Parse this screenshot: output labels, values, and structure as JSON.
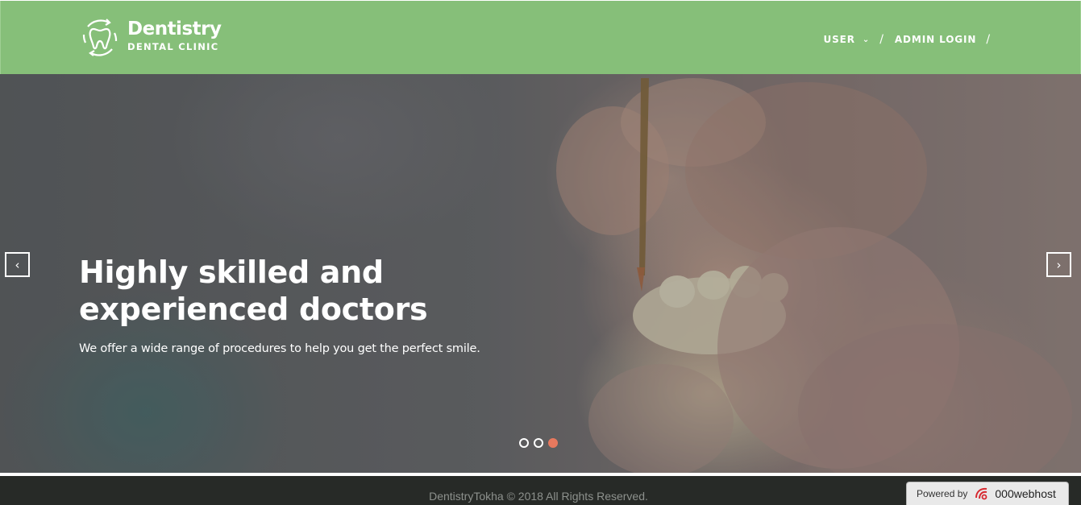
{
  "header": {
    "brand_title": "Dentistry",
    "brand_subtitle": "DENTAL CLINIC",
    "bg_color": "#86bf79",
    "nav": [
      {
        "label": "USER",
        "has_dropdown": true
      },
      {
        "label": "ADMIN LOGIN",
        "has_dropdown": false
      }
    ],
    "separator": "/"
  },
  "hero": {
    "title_line1": "Highly skilled and",
    "title_line2": "experienced doctors",
    "subtitle": "We offer a wide range of procedures to help you get the perfect smile.",
    "prev_icon": "‹",
    "next_icon": "›",
    "slides_total": 3,
    "active_slide": 3,
    "active_dot_color": "#e8795e"
  },
  "footer": {
    "copyright": "DentistryTokha © 2018 All Rights Reserved.",
    "bg_color": "#272a27",
    "badge_label": "Powered by",
    "badge_brand": "000webhost"
  }
}
